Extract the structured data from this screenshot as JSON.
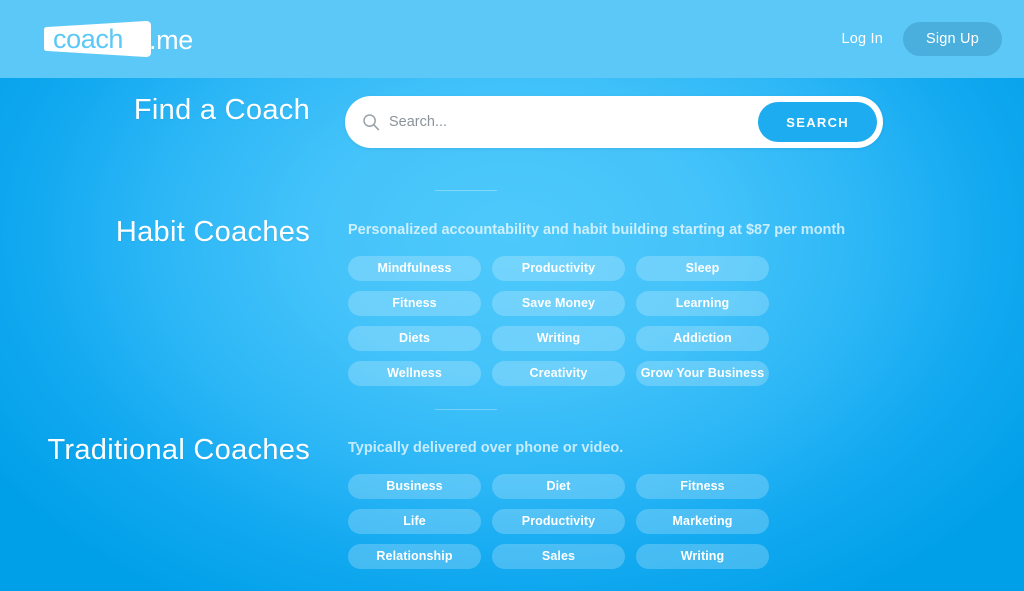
{
  "header": {
    "logo_text_primary": "coach",
    "logo_text_secondary": ".me",
    "login_label": "Log In",
    "signup_label": "Sign Up"
  },
  "search": {
    "title": "Find a Coach",
    "placeholder": "Search...",
    "value": "",
    "button_label": "SEARCH",
    "icon": "search-icon"
  },
  "sections": [
    {
      "title": "Habit Coaches",
      "subtitle": "Personalized accountability and habit building starting at $87 per month",
      "tags": [
        "Mindfulness",
        "Productivity",
        "Sleep",
        "Fitness",
        "Save Money",
        "Learning",
        "Diets",
        "Writing",
        "Addiction",
        "Wellness",
        "Creativity",
        "Grow Your Business"
      ]
    },
    {
      "title": "Traditional Coaches",
      "subtitle": "Typically delivered over phone or video.",
      "tags": [
        "Business",
        "Diet",
        "Fitness",
        "Life",
        "Productivity",
        "Marketing",
        "Relationship",
        "Sales",
        "Writing"
      ]
    }
  ],
  "colors": {
    "header_bg": "#5bc8f7",
    "page_bg_center": "#4ec9fb",
    "page_bg_edge": "#00a0e9",
    "signup_bg": "#4aafdd",
    "search_button_bg": "#1eacf0",
    "tag_bg": "rgba(255,255,255,.22)",
    "text_on_blue": "#ffffff"
  }
}
